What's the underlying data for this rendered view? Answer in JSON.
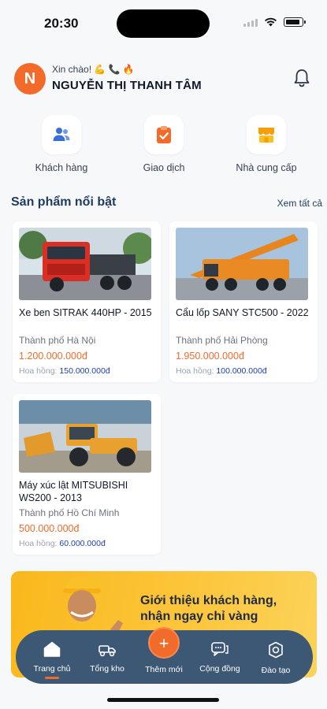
{
  "status_bar": {
    "time": "20:30"
  },
  "header": {
    "avatar_letter": "N",
    "greeting": "Xin chào! 💪 📞 🔥",
    "user_name": "NGUYỄN THỊ THANH TÂM"
  },
  "quick_actions": [
    {
      "label": "Khách hàng",
      "icon": "users-icon"
    },
    {
      "label": "Giao dịch",
      "icon": "clipboard-check-icon"
    },
    {
      "label": "Nhà cung cấp",
      "icon": "store-icon"
    }
  ],
  "featured": {
    "title": "Sản phẩm nổi bật",
    "see_all": "Xem tất cả",
    "commission_label": "Hoa hồng:",
    "products": [
      {
        "name": "Xe ben SITRAK 440HP - 2015",
        "city": "Thành phố Hà Nội",
        "price": "1.200.000.000đ",
        "commission": "150.000.000đ"
      },
      {
        "name": "Cẩu lốp SANY STC500 - 2022",
        "city": "Thành phố Hải Phòng",
        "price": "1.950.000.000đ",
        "commission": "100.000.000đ"
      },
      {
        "name": "Máy xúc lật MITSUBISHI WS200 - 2013",
        "city": "Thành phố Hồ Chí Minh",
        "price": "500.000.000đ",
        "commission": "60.000.000đ"
      }
    ]
  },
  "banner": {
    "line1": "Giới thiệu khách hàng,",
    "line2": "nhận ngay chỉ vàng"
  },
  "nav": {
    "items": [
      {
        "label": "Trang chủ",
        "icon": "home-icon",
        "active": true
      },
      {
        "label": "Tổng kho",
        "icon": "truck-icon"
      },
      {
        "label": "Thêm mới",
        "icon": "plus-icon"
      },
      {
        "label": "Cộng đồng",
        "icon": "chat-icon"
      },
      {
        "label": "Đào tạo",
        "icon": "training-icon"
      }
    ],
    "add_symbol": "+"
  },
  "colors": {
    "accent": "#f26b2b",
    "navy": "#1e3a5f",
    "nav_bg": "#3c5875",
    "banner": "#fcc53a"
  }
}
